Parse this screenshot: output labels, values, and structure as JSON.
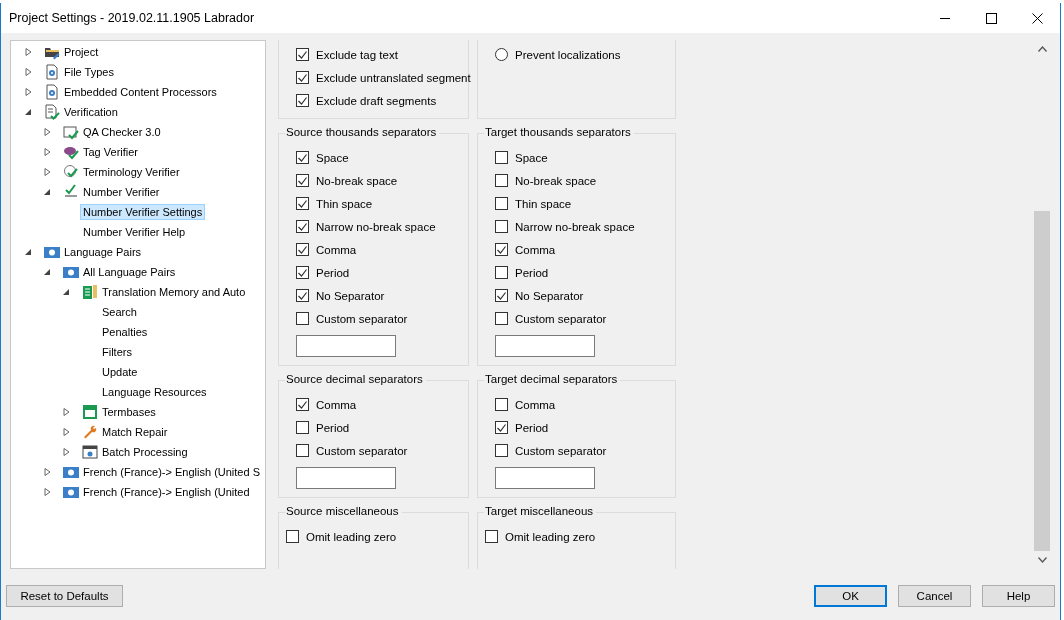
{
  "window": {
    "title": "Project Settings - 2019.02.11.1905 Labrador"
  },
  "tree": [
    {
      "label": "Project",
      "kind": "folder",
      "expanded": false,
      "selected": false
    },
    {
      "label": "File Types",
      "kind": "gear-doc",
      "expanded": false,
      "selected": false
    },
    {
      "label": "Embedded Content Processors",
      "kind": "gear-doc",
      "expanded": false,
      "selected": false
    },
    {
      "label": "Verification",
      "kind": "check-doc",
      "expanded": true,
      "selected": false,
      "children": [
        {
          "label": "QA Checker 3.0",
          "kind": "qa",
          "expanded": false,
          "selected": false
        },
        {
          "label": "Tag Verifier",
          "kind": "tag",
          "expanded": false,
          "selected": false
        },
        {
          "label": "Terminology Verifier",
          "kind": "term",
          "expanded": false,
          "selected": false
        },
        {
          "label": "Number Verifier",
          "kind": "number",
          "expanded": true,
          "selected": false,
          "children": [
            {
              "label": "Number Verifier Settings",
              "selected": true
            },
            {
              "label": "Number Verifier Help",
              "selected": false
            }
          ]
        }
      ]
    },
    {
      "label": "Language Pairs",
      "kind": "lang",
      "expanded": true,
      "selected": false,
      "children": [
        {
          "label": "All Language Pairs",
          "kind": "lang",
          "expanded": true,
          "selected": false,
          "children": [
            {
              "label": "Translation Memory and Auto",
              "kind": "tm",
              "expanded": true,
              "selected": false,
              "children": [
                {
                  "label": "Search",
                  "selected": false
                },
                {
                  "label": "Penalties",
                  "selected": false
                },
                {
                  "label": "Filters",
                  "selected": false
                },
                {
                  "label": "Update",
                  "selected": false
                },
                {
                  "label": "Language Resources",
                  "selected": false
                }
              ]
            },
            {
              "label": "Termbases",
              "kind": "termbase",
              "expanded": false,
              "selected": false
            },
            {
              "label": "Match Repair",
              "kind": "wrench",
              "expanded": false,
              "selected": false
            },
            {
              "label": "Batch Processing",
              "kind": "batch",
              "expanded": false,
              "selected": false
            }
          ]
        },
        {
          "label": "French (France)-> English (United S",
          "kind": "lang",
          "expanded": false,
          "selected": false
        },
        {
          "label": "French (France)-> English (United",
          "kind": "lang",
          "expanded": false,
          "selected": false
        }
      ]
    }
  ],
  "group_rows": [
    [
      {
        "items": [
          {
            "kind": "checkbox",
            "label": "Exclude tag text",
            "checked": true
          },
          {
            "kind": "checkbox",
            "label": "Exclude untranslated segment",
            "checked": true
          },
          {
            "kind": "checkbox",
            "label": "Exclude draft segments",
            "checked": true
          }
        ]
      },
      {
        "items": [
          {
            "kind": "radio",
            "label": "Prevent localizations",
            "selected": false
          }
        ]
      }
    ],
    [
      {
        "title": "Source thousands separators",
        "items": [
          {
            "kind": "checkbox",
            "label": "Space",
            "checked": true
          },
          {
            "kind": "checkbox",
            "label": "No-break space",
            "checked": true
          },
          {
            "kind": "checkbox",
            "label": "Thin space",
            "checked": true
          },
          {
            "kind": "checkbox",
            "label": "Narrow no-break space",
            "checked": true
          },
          {
            "kind": "checkbox",
            "label": "Comma",
            "checked": true
          },
          {
            "kind": "checkbox",
            "label": "Period",
            "checked": true
          },
          {
            "kind": "checkbox",
            "label": "No Separator",
            "checked": true
          },
          {
            "kind": "checkbox",
            "label": "Custom separator",
            "checked": false
          },
          {
            "kind": "field"
          }
        ]
      },
      {
        "title": "Target thousands separators",
        "items": [
          {
            "kind": "checkbox",
            "label": "Space",
            "checked": false
          },
          {
            "kind": "checkbox",
            "label": "No-break space",
            "checked": false
          },
          {
            "kind": "checkbox",
            "label": "Thin space",
            "checked": false
          },
          {
            "kind": "checkbox",
            "label": "Narrow no-break space",
            "checked": false
          },
          {
            "kind": "checkbox",
            "label": "Comma",
            "checked": true
          },
          {
            "kind": "checkbox",
            "label": "Period",
            "checked": false
          },
          {
            "kind": "checkbox",
            "label": "No Separator",
            "checked": true
          },
          {
            "kind": "checkbox",
            "label": "Custom separator",
            "checked": false
          },
          {
            "kind": "field"
          }
        ]
      }
    ],
    [
      {
        "title": "Source decimal separators",
        "items": [
          {
            "kind": "checkbox",
            "label": "Comma",
            "checked": true
          },
          {
            "kind": "checkbox",
            "label": "Period",
            "checked": false
          },
          {
            "kind": "checkbox",
            "label": "Custom separator",
            "checked": false
          },
          {
            "kind": "field"
          }
        ]
      },
      {
        "title": "Target decimal separators",
        "items": [
          {
            "kind": "checkbox",
            "label": "Comma",
            "checked": false
          },
          {
            "kind": "checkbox",
            "label": "Period",
            "checked": true
          },
          {
            "kind": "checkbox",
            "label": "Custom separator",
            "checked": false
          },
          {
            "kind": "field"
          }
        ]
      }
    ],
    [
      {
        "title": "Source miscellaneous",
        "items": [
          {
            "kind": "checkbox",
            "label": "Omit leading zero",
            "checked": false
          }
        ]
      },
      {
        "title": "Target miscellaneous",
        "items": [
          {
            "kind": "checkbox",
            "label": "Omit leading zero",
            "checked": false
          }
        ]
      }
    ]
  ],
  "footer": {
    "left": [
      {
        "label": "Reset to Defaults",
        "focused": false
      }
    ],
    "right": [
      {
        "label": "OK",
        "focused": true
      },
      {
        "label": "Cancel",
        "focused": false
      },
      {
        "label": "Help",
        "focused": false
      }
    ]
  }
}
